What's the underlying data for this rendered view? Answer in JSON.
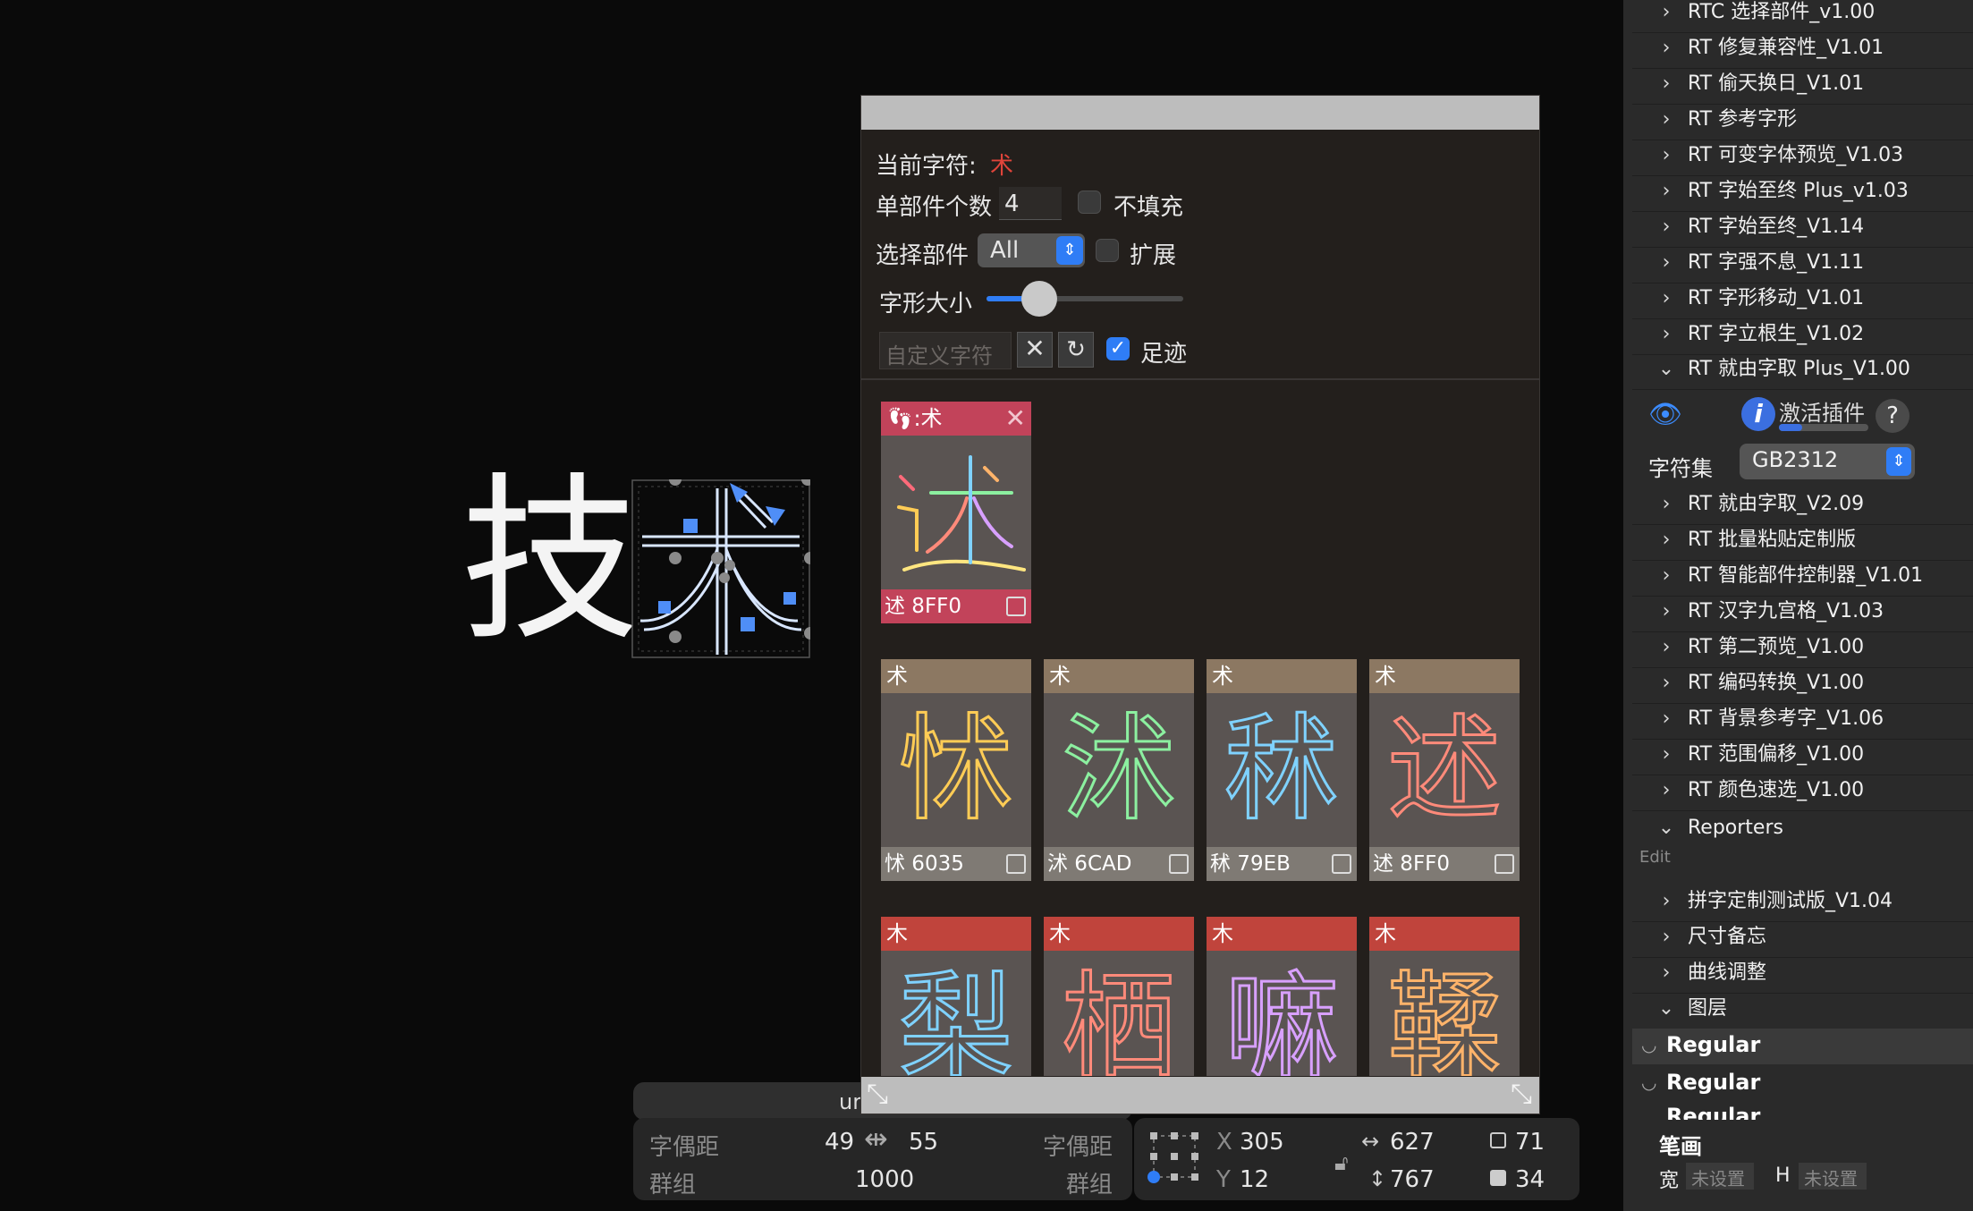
{
  "canvas": {
    "glyph_left": "技",
    "glyph_right": "术"
  },
  "panel": {
    "current_char_label": "当前字符:",
    "current_char": "术",
    "count_label": "单部件个数",
    "count_value": "4",
    "nofill_label": "不填充",
    "select_label": "选择部件",
    "select_value": "All",
    "expand_label": "扩展",
    "size_label": "字形大小",
    "size_value": 0.27,
    "custom_placeholder": "自定义字符",
    "footprint_label": "足迹",
    "history_tile": {
      "header": ":术",
      "glyph": "述",
      "code": "述 8FF0"
    },
    "row1": [
      {
        "header": "术",
        "glyph": "怵",
        "code": "怵 6035"
      },
      {
        "header": "术",
        "glyph": "沭",
        "code": "沭 6CAD"
      },
      {
        "header": "术",
        "glyph": "秫",
        "code": "秫 79EB"
      },
      {
        "header": "术",
        "glyph": "述",
        "code": "述 8FF0"
      }
    ],
    "row2": [
      {
        "header": "木",
        "glyph": "梨"
      },
      {
        "header": "木",
        "glyph": "栖"
      },
      {
        "header": "木",
        "glyph": "嘛"
      },
      {
        "header": "木",
        "glyph": "鞣"
      }
    ],
    "colors": {
      "history_header": "#c2435a",
      "row1_header": "#8c7862",
      "row2_header": "#c0443c",
      "accent_red": "#e0443a"
    }
  },
  "statusbar": {
    "left": {
      "kerning_left_label": "字偶距",
      "kerning_left_value": "49",
      "kerning_right_value": "55",
      "kerning_right_label": "字偶距",
      "group_left_label": "群组",
      "width_value": "1000",
      "group_right_label": "群组",
      "overlay_text": "ur"
    },
    "right": {
      "x_label": "X",
      "x_value": "305",
      "y_label": "Y",
      "y_value": "12",
      "w_value": "627",
      "h_value": "767",
      "a_value": "71",
      "b_value": "34"
    }
  },
  "sidebar": {
    "items_top": [
      "RTC 选择部件_v1.00",
      "RT 修复兼容性_V1.01",
      "RT 偷天换日_V1.01",
      "RT 参考字形",
      "RT 可变字体预览_V1.03",
      "RT 字始至终 Plus_v1.03",
      "RT 字始至终_V1.14",
      "RT 字强不息_V1.11",
      "RT 字形移动_V1.01",
      "RT 字立根生_V1.02"
    ],
    "expanded_item": "RT 就由字取 Plus_V1.00",
    "activate_label": "激活插件",
    "charset_label": "字符集",
    "charset_value": "GB2312",
    "items_mid": [
      "RT 就由字取_V2.09",
      "RT 批量粘贴定制版",
      "RT 智能部件控制器_V1.01",
      "RT 汉字九宫格_V1.03",
      "RT 第二预览_V1.00",
      "RT 编码转换_V1.00",
      "RT 背景参考字_V1.06",
      "RT 范围偏移_V1.00",
      "RT 颜色速选_V1.00"
    ],
    "reporters_label": "Reporters",
    "edit_label": "Edit",
    "items_after": [
      "拼字定制测试版_V1.04",
      "尺寸备忘",
      "曲线调整"
    ],
    "layers_label": "图层",
    "layers": [
      "Regular",
      "Regular",
      "Regular"
    ],
    "stroke_label": "笔画",
    "width_label": "宽",
    "width_value": "未设置",
    "height_label": "H",
    "height_value": "未设置"
  }
}
